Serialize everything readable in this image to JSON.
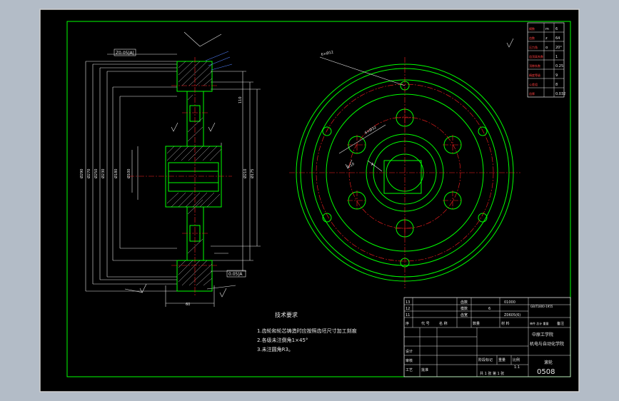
{
  "colors": {
    "desktop": "#b3bcc7",
    "canvas": "#000000",
    "frame": "#ffffff",
    "border": "#00ff00",
    "outline": "#00ff00",
    "center_line": "#ff2020",
    "dimension": "#ffffff",
    "hatch": "#c8c8c8",
    "leader_blue": "#5080ff"
  },
  "drawing": {
    "view": "front-section and side views of a cast wheel / pulley",
    "technical_requirements": {
      "title": "技术要求",
      "items": [
        "1.齿轮和轮芯铸造时应按照齿坯尺寸加工刻痕",
        "2.各级未注倒角1×45°",
        "3.未注圆角R3。"
      ]
    },
    "side_labels": {
      "top": "Z0.05|A|",
      "bottom": "0.05|A"
    },
    "title_block": {
      "parts_rows": [
        {
          "idx": "13",
          "name": "齿数",
          "val": "01000"
        },
        {
          "idx": "12",
          "name": "模数",
          "val": "6"
        },
        {
          "idx": "11",
          "name": "齿宽",
          "val": "Z0605(6)"
        }
      ],
      "standard": "GB/T1800-1955",
      "school": "中原工学院",
      "dept": "机电与自动化学院",
      "part_name": "滚轮",
      "drawing_no": "0508",
      "header_cells": [
        "序",
        "代 号",
        "名 称",
        "数量",
        "材 料",
        "单件 总计 重量",
        "备注"
      ],
      "sign_rows": [
        "设计",
        "审核",
        "工艺",
        "批准"
      ],
      "scale_label": "比例",
      "scale_value": "1:1",
      "sheet_text": "共 1 张   第 1 张",
      "weight_label": "重量",
      "stage_label": "阶段标记"
    },
    "param_table": {
      "rows": [
        [
          "m",
          "6"
        ],
        [
          "z",
          "64"
        ],
        [
          "α",
          "20°"
        ],
        [
          "",
          "1"
        ],
        [
          "",
          "0.25"
        ],
        [
          "",
          "9"
        ],
        [
          "",
          "8"
        ],
        [
          "",
          "0.032"
        ]
      ]
    },
    "roughness_mark": "Ra 6.3"
  }
}
